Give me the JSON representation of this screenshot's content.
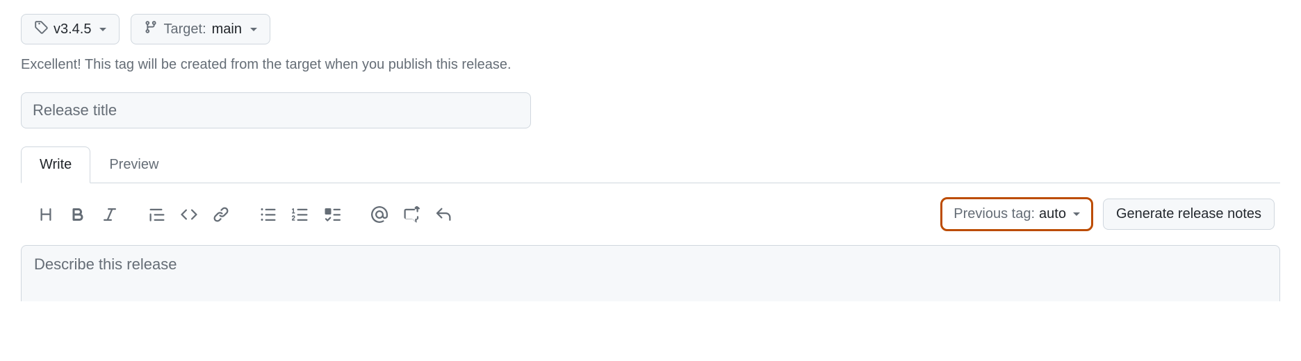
{
  "tag_selector": {
    "tag": "v3.4.5",
    "target_label": "Target:",
    "target_value": "main"
  },
  "helper_text": "Excellent! This tag will be created from the target when you publish this release.",
  "title_input": {
    "placeholder": "Release title",
    "value": ""
  },
  "tabs": {
    "write": "Write",
    "preview": "Preview"
  },
  "previous_tag": {
    "label": "Previous tag:",
    "value": "auto"
  },
  "generate_notes_label": "Generate release notes",
  "description": {
    "placeholder": "Describe this release",
    "value": ""
  }
}
